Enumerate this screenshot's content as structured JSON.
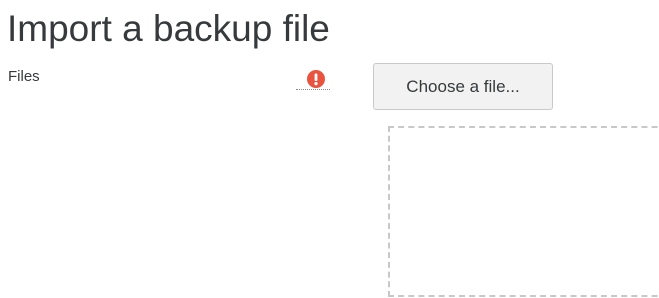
{
  "page": {
    "title": "Import a backup file"
  },
  "form": {
    "files_label": "Files",
    "required_icon": "exclamation-circle-icon",
    "required_color": "#e8543f",
    "choose_button_label": "Choose a file..."
  }
}
